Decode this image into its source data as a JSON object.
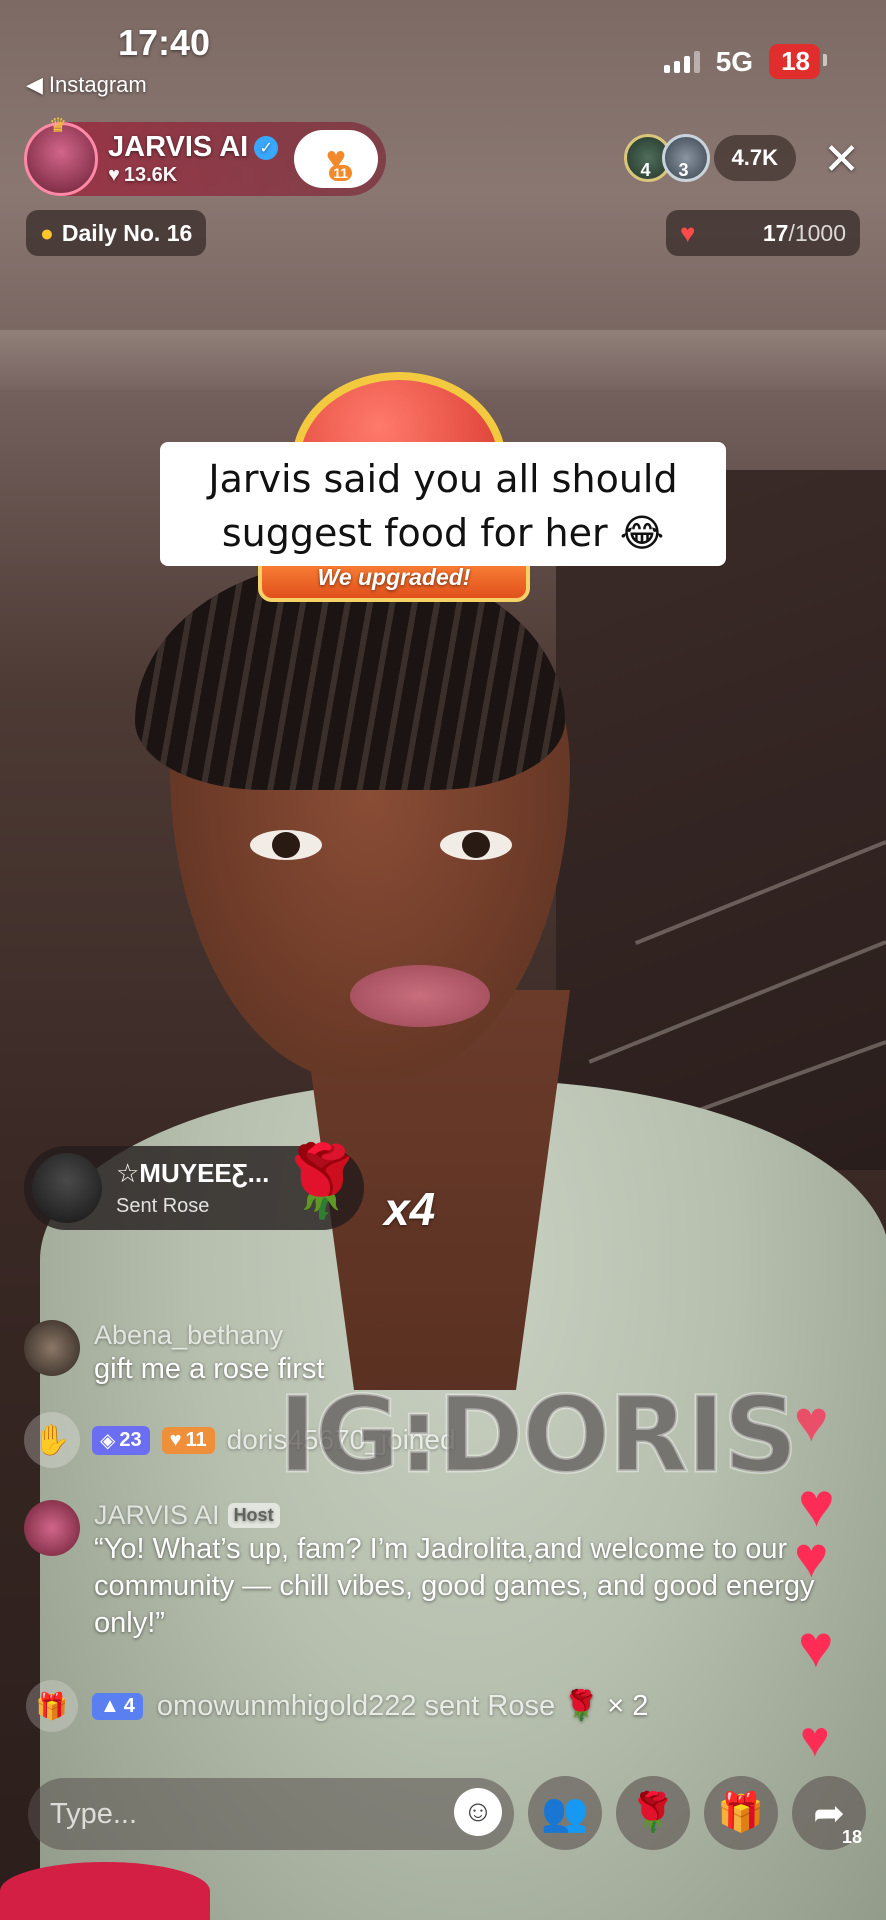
{
  "status_bar": {
    "time": "17:40",
    "back_app": "Instagram",
    "network": "5G",
    "battery": "18"
  },
  "host": {
    "name": "JARVIS AI",
    "likes": "13.6K",
    "follow_count": "11"
  },
  "viewers": {
    "top1_rank": "4",
    "top2_rank": "3",
    "count": "4.7K"
  },
  "daily": {
    "label": "Daily No. 16"
  },
  "goal": {
    "current": "17",
    "total": "/1000"
  },
  "upgrade": {
    "label": "We upgraded!"
  },
  "caption": {
    "line1": "Jarvis said you all should",
    "line2": "suggest food for her 😂"
  },
  "gift_banner": {
    "user": "☆MUYEEƸ...",
    "action": "Sent Rose",
    "multiplier": "x4"
  },
  "chat": [
    {
      "user": "Abena_bethany",
      "text": "gift me a rose first"
    },
    {
      "user": "JARVIS AI",
      "tag": "Host",
      "text": "“Yo! What’s up, fam? I’m Jadrolita,and welcome to our community — chill vibes, good games, and good energy only!”"
    }
  ],
  "join": {
    "level": "23",
    "fan_level": "11",
    "text": "doris45670_joined"
  },
  "gift_message": {
    "level": "4",
    "text": "omowunmhigold222 sent Rose",
    "count": "× 2"
  },
  "watermark": "IG:DORIS",
  "input": {
    "placeholder": "Type..."
  },
  "share": {
    "count": "18"
  },
  "colors": {
    "like_red": "#ff2d55",
    "battery_red": "#e22d2d",
    "level_badge": "#6b6ef0"
  }
}
